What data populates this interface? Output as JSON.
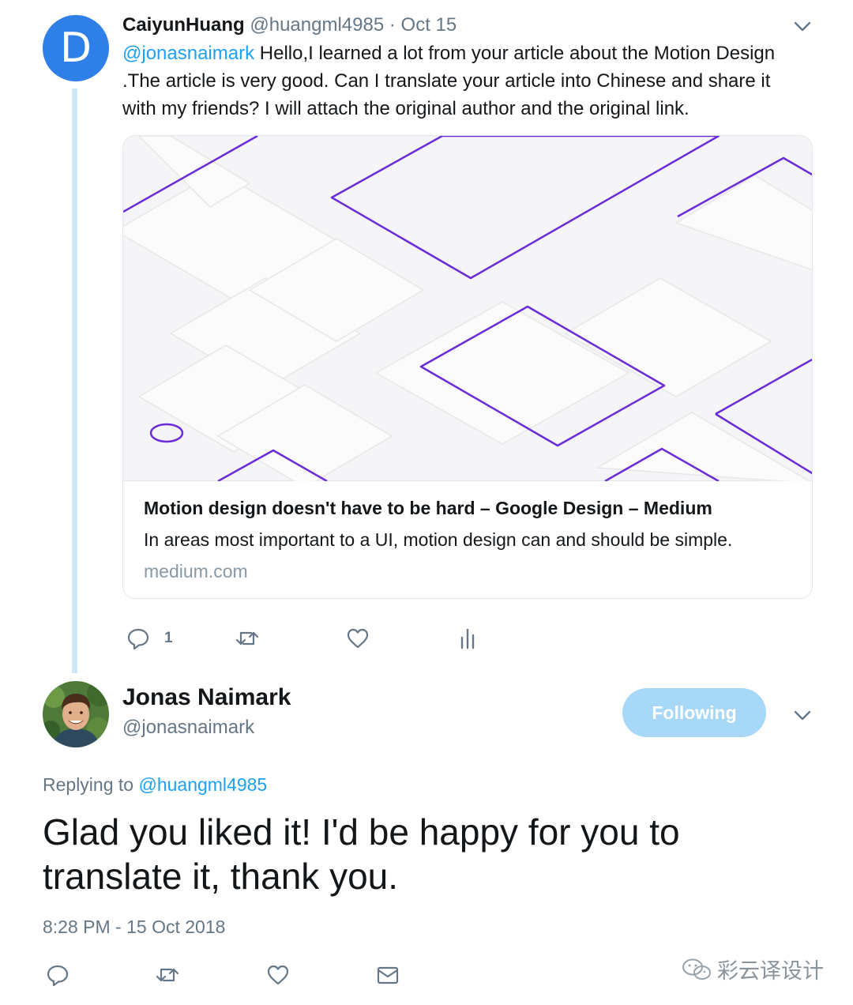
{
  "tweet1": {
    "avatar_letter": "D",
    "name": "CaiyunHuang",
    "handle": "@huangml4985",
    "separator": "·",
    "date": "Oct 15",
    "mention": "@jonasnaimark",
    "text": " Hello,I learned a lot from your article about the Motion Design .The article is very good. Can I translate your article into Chinese and share it with my friends? I will attach the original author and the original link.",
    "card": {
      "title": "Motion design doesn't have to be hard – Google Design – Medium",
      "description": "In areas most important to a UI, motion design can and should be simple.",
      "domain": "medium.com",
      "accent_color": "#6c2bd9"
    },
    "actions": {
      "reply_icon": "reply-icon",
      "reply_count": "1",
      "retweet_icon": "retweet-icon",
      "like_icon": "heart-icon",
      "analytics_icon": "analytics-icon"
    }
  },
  "tweet2": {
    "name": "Jonas Naimark",
    "handle": "@jonasnaimark",
    "follow_label": "Following",
    "replying_prefix": "Replying to ",
    "replying_handle": "@huangml4985",
    "text": "Glad you liked it! I'd be happy for you to translate it, thank you.",
    "timestamp": "8:28 PM - 15 Oct 2018",
    "actions": {
      "reply_icon": "reply-icon",
      "retweet_icon": "retweet-icon",
      "like_icon": "heart-icon",
      "dm_icon": "envelope-icon"
    }
  },
  "watermark": {
    "text": "彩云译设计",
    "icon": "wechat-icon"
  },
  "colors": {
    "link": "#1da1f2",
    "secondary": "#657786",
    "thread_line": "#cde7f7",
    "follow_button": "#a8d8f8"
  }
}
